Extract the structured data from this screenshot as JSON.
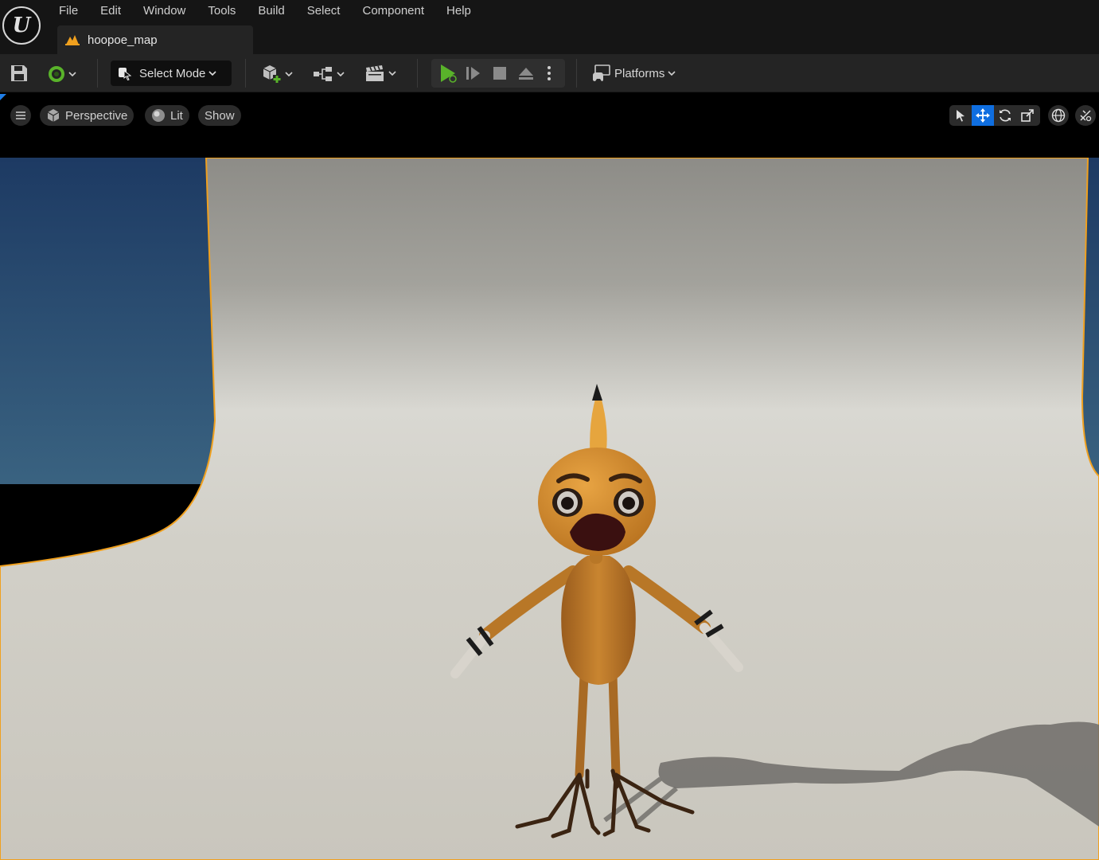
{
  "app": {
    "logo_letter": "U",
    "menu": [
      "File",
      "Edit",
      "Window",
      "Tools",
      "Build",
      "Select",
      "Component",
      "Help"
    ],
    "document_tab": "hoopoe_map"
  },
  "toolbar": {
    "select_mode_label": "Select Mode",
    "platforms_label": "Platforms"
  },
  "viewport": {
    "perspective_label": "Perspective",
    "lit_label": "Lit",
    "show_label": "Show",
    "selection_outline_color": "#f0a01e",
    "accent_color": "#0f6ee0"
  },
  "icons": {
    "save": "save-icon",
    "source_control": "source-control-icon",
    "select_mode": "cursor-select-icon",
    "add_content": "add-actor-icon",
    "blueprints": "blueprint-icon",
    "cinematics": "clapperboard-icon",
    "play": "play-icon",
    "advance_frame": "step-icon",
    "stop": "stop-icon",
    "eject": "eject-icon",
    "more": "more-options-icon",
    "platforms": "platforms-icon"
  }
}
